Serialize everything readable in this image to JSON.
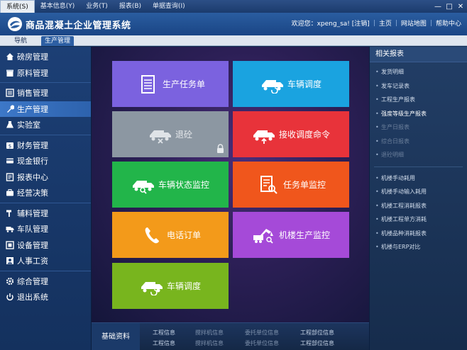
{
  "menubar": {
    "items": [
      "系统(S)",
      "基本信息(Y)",
      "业务(T)",
      "报表(B)",
      "单据查询(I)"
    ]
  },
  "window_controls": {
    "minimize": "—",
    "maximize": "□",
    "close": "✕"
  },
  "header": {
    "title": "商品混凝土企业管理系统",
    "welcome": "欢迎您：xpeng_sa! [注销]",
    "links": [
      "主页",
      "网站地图",
      "帮助中心"
    ]
  },
  "tabs": {
    "nav": "导航",
    "production": "生产管理"
  },
  "sidebar": {
    "groups": [
      [
        {
          "label": "磅房管理",
          "icon": "home-icon"
        },
        {
          "label": "原料管理",
          "icon": "box-icon"
        }
      ],
      [
        {
          "label": "销售管理",
          "icon": "list-icon"
        },
        {
          "label": "生产管理",
          "icon": "wrench-icon",
          "active": true
        },
        {
          "label": "实验室",
          "icon": "flask-icon"
        }
      ],
      [
        {
          "label": "财务管理",
          "icon": "money-icon"
        },
        {
          "label": "现金银行",
          "icon": "card-icon"
        },
        {
          "label": "报表中心",
          "icon": "report-icon"
        },
        {
          "label": "经营决策",
          "icon": "briefcase-icon"
        }
      ],
      [
        {
          "label": "辅料管理",
          "icon": "hammer-icon"
        },
        {
          "label": "车队管理",
          "icon": "truck-icon"
        },
        {
          "label": "设备管理",
          "icon": "equipment-icon"
        },
        {
          "label": "人事工资",
          "icon": "person-icon"
        }
      ],
      [
        {
          "label": "综合管理",
          "icon": "gear-icon"
        },
        {
          "label": "退出系统",
          "icon": "power-icon"
        }
      ]
    ]
  },
  "tiles": [
    {
      "label": "生产任务单",
      "icon": "document-icon"
    },
    {
      "label": "车辆调度",
      "icon": "mixer-truck-refresh-icon"
    },
    {
      "label": "退砼",
      "icon": "mixer-truck-cancel-icon",
      "locked": true
    },
    {
      "label": "接收调度命令",
      "icon": "mixer-truck-upload-icon"
    },
    {
      "label": "车辆状态监控",
      "icon": "mixer-truck-search-icon"
    },
    {
      "label": "任务单监控",
      "icon": "document-search-icon"
    },
    {
      "label": "电话订单",
      "icon": "phone-icon"
    },
    {
      "label": "机楼生产监控",
      "icon": "excavator-search-icon"
    },
    {
      "label": "车辆调度",
      "icon": "mixer-truck-refresh-icon"
    }
  ],
  "bottom": {
    "title": "基础资料",
    "rows": [
      [
        "工程信息",
        "搅拌机信息",
        "委托单位信息",
        "工程部位信息"
      ],
      [
        "工程信息",
        "搅拌机信息",
        "委托单位信息",
        "工程部位信息"
      ]
    ]
  },
  "right_panel": {
    "title": "相关报表",
    "group1": [
      {
        "label": "发货明细",
        "state": "normal"
      },
      {
        "label": "发车记录表",
        "state": "normal"
      },
      {
        "label": "工程生产报表",
        "state": "normal"
      },
      {
        "label": "强度等级生产报表",
        "state": "bright"
      },
      {
        "label": "生产日报表",
        "state": "dim"
      },
      {
        "label": "综合日报表",
        "state": "dim"
      },
      {
        "label": "退砼明细",
        "state": "dim"
      }
    ],
    "group2": [
      {
        "label": "机楼手动耗用",
        "state": "normal"
      },
      {
        "label": "机楼手动输入耗用",
        "state": "normal"
      },
      {
        "label": "机楼工程消耗报表",
        "state": "normal"
      },
      {
        "label": "机楼工程单方消耗",
        "state": "normal"
      },
      {
        "label": "机楼品种消耗报表",
        "state": "normal"
      },
      {
        "label": "机楼与ERP对比",
        "state": "normal"
      }
    ]
  },
  "colors": {
    "header": "#2a5da0",
    "sidebar_active": "#3d78c8",
    "tile_purple": "#7b62df",
    "tile_cyan": "#1aa3e0",
    "tile_gray": "#8c97a2",
    "tile_red": "#e8333a",
    "tile_green": "#22b54a",
    "tile_orange": "#f0561c",
    "tile_amber": "#f39a1a",
    "tile_violet": "#a54ad8",
    "tile_lime": "#78b51e"
  }
}
